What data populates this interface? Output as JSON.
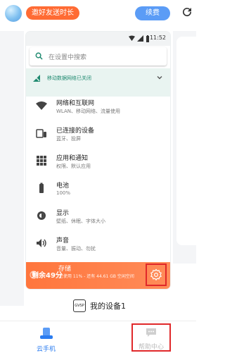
{
  "header": {
    "promo_label": "邀好友送时长",
    "renew_label": "续费"
  },
  "phone": {
    "status_time": "11:52",
    "search_placeholder": "在设置中搜索",
    "banner_text": "移动数据网络已关闭",
    "items": [
      {
        "title": "网络和互联网",
        "sub": "WLAN、移动网络、流量使用",
        "icon": "wifi-icon"
      },
      {
        "title": "已连接的设备",
        "sub": "蓝牙、投屏",
        "icon": "devices-icon"
      },
      {
        "title": "应用和通知",
        "sub": "权限、默认应用",
        "icon": "apps-icon"
      },
      {
        "title": "电池",
        "sub": "100%",
        "icon": "battery-icon"
      },
      {
        "title": "显示",
        "sub": "壁纸、休眠、字体大小",
        "icon": "display-icon"
      },
      {
        "title": "声音",
        "sub": "音量、振动、勿扰",
        "icon": "volume-icon"
      }
    ],
    "storage_title": "存储",
    "storage_sub": "已使用 11% - 还有 44.61 GB 空闲空间"
  },
  "overlay": {
    "remaining": "剩余49分"
  },
  "device": {
    "badge": "GVSP",
    "name": "我的设备1"
  },
  "bottom_nav": {
    "cloud_phone": "云手机",
    "help_center": "帮助中心"
  },
  "colors": {
    "accent_blue": "#2b7cf0",
    "promo_orange": "#ff6b34",
    "highlight_red": "#e0282a",
    "settings_teal": "#1f8a70"
  }
}
